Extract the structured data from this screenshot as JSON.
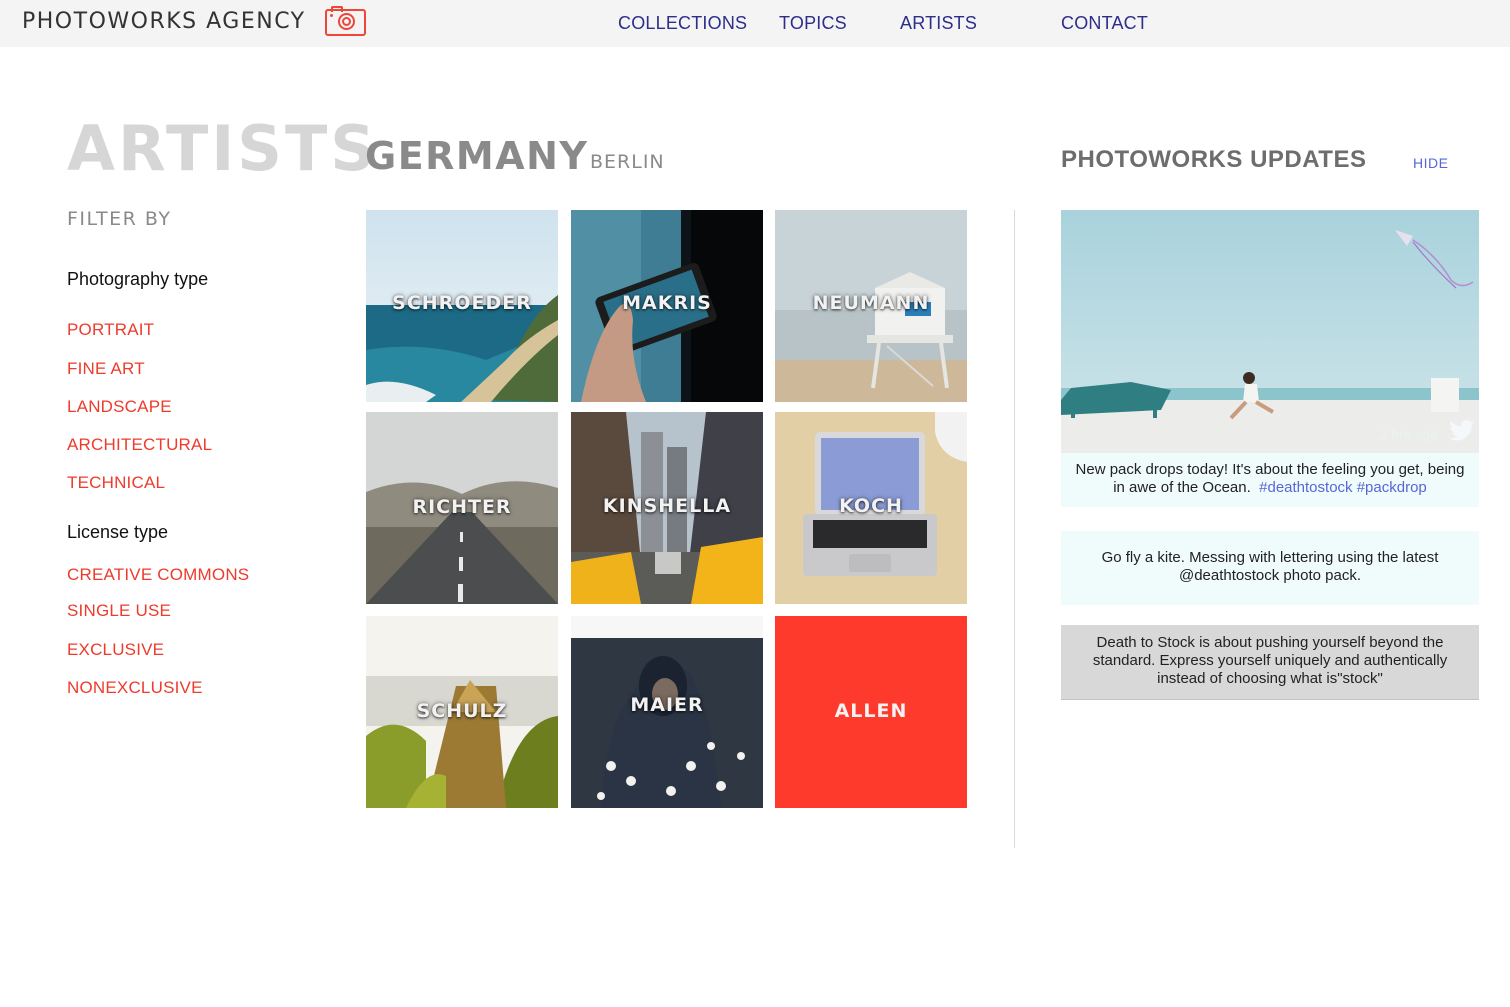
{
  "header": {
    "brand": "PHOTOWORKS AGENCY",
    "brand_icon": "camera-icon",
    "nav": [
      "COLLECTIONS",
      "TOPICS",
      "ARTISTS",
      "CONTACT"
    ]
  },
  "page": {
    "title": "ARTISTS",
    "country": "GERMANY",
    "city": "BERLIN"
  },
  "filters": {
    "heading": "FILTER BY",
    "photography_type": {
      "label": "Photography type",
      "items": [
        "PORTRAIT",
        "FINE ART",
        "LANDSCAPE",
        "ARCHITECTURAL",
        "TECHNICAL"
      ]
    },
    "license_type": {
      "label": "License type",
      "items": [
        "CREATIVE COMMONS",
        "SINGLE USE",
        "EXCLUSIVE",
        "NONEXCLUSIVE"
      ]
    }
  },
  "artists": [
    {
      "name": "SCHROEDER",
      "scene": "coastline"
    },
    {
      "name": "MAKRIS",
      "scene": "phone-in-hand"
    },
    {
      "name": "NEUMANN",
      "scene": "lifeguard-tower"
    },
    {
      "name": "RICHTER",
      "scene": "mountain-road"
    },
    {
      "name": "KINSHELLA",
      "scene": "city-taxis"
    },
    {
      "name": "KOCH",
      "scene": "laptop-desk"
    },
    {
      "name": "SCHULZ",
      "scene": "canoe-lake"
    },
    {
      "name": "MAIER",
      "scene": "hooded-figure-flowers"
    },
    {
      "name": "ALLEN",
      "scene": "solid-red"
    }
  ],
  "updates": {
    "title": "PHOTOWORKS UPDATES",
    "hide_label": "HIDE",
    "posts": [
      {
        "time": "2 hrs ago",
        "icon": "twitter-icon",
        "text": "New pack drops today! It's about the feeling you get, being in awe of the Ocean.",
        "tags": [
          "#deathtostock",
          "#packdrop"
        ]
      },
      {
        "text": "Go fly a kite. Messing with lettering using the latest @deathtostock photo pack."
      },
      {
        "text": "Death to Stock is about pushing yourself beyond the standard. Express yourself uniquely and authentically instead of choosing what is\"stock\""
      }
    ]
  },
  "colors": {
    "accent": "#ee3b2c",
    "nav": "#2d2d8a",
    "link": "#5966d8",
    "allen_tile": "#fe3a2c"
  }
}
